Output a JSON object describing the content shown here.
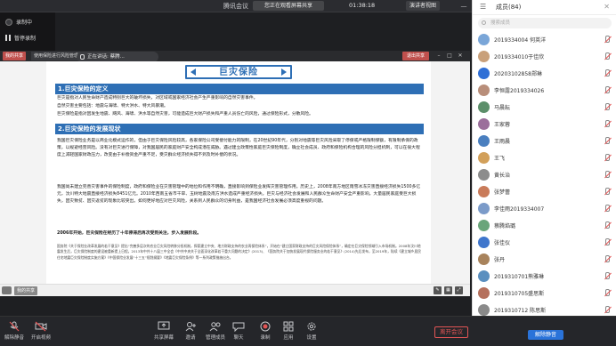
{
  "titlebar": {
    "title": "腾讯会议",
    "share_banner": "您正在观看屏幕共享",
    "timer": "01:38:18",
    "rec_label": "",
    "view_button": "演讲者视图",
    "controls": [
      "—",
      "□",
      "✕"
    ]
  },
  "recording": {
    "status": "录制中",
    "pause": "暂停录制"
  },
  "share_strip": {
    "tag": "我的共享",
    "tab": "使用保险进行风险管理",
    "exit": "退出共享"
  },
  "speaker": {
    "label": "正在讲话: 蔡腾..."
  },
  "slide": {
    "title": "巨灾保险",
    "section1": "1.巨灾保险的定义",
    "para1": "巨灾是指对人民生命财产造成特别巨大的破坏损失，对区域或国家经济社会产生严重影响的自然灾害事件。",
    "para2": "自然灾害主要包括：地震与海啸、特大洪水、特大风暴潮。",
    "para3": "巨灾保险是指对因发生地震、飓风、海啸、洪水等自然灾害，可能造成巨大财产损失和严重人员伤亡的风险，通过保险形式，分散风险。",
    "section2": "2.巨灾保险的发展现状",
    "para4": "我国巨灾保险业务是以商业化模式运作的，但由于巨灾保险风险较高，各家保险公司受偿付能力的限制，在20世纪90年代，分别对地震等巨灾风险采取了停保或严格限制保额，有限制承保的政策，以规避经营风险。没有对巨灾进行保障，对我国居民的家庭财产安全构成潜在威胁。遇过建立政策性家庭巨灾保险制度，确立社会成员、政府和保险机构合理的风险分担机制，可以在很大程度上减轻国家财政压力，改变由于补偿资金严重不足，受灾群众经济损失得不到及时补偿的状况。",
    "para5": "我国尚未建立完善灾害事件的保险制度，政府和保险业在灾害管理中的地位和作用不明确，直接影响到保险业发挥灾害管理作用。历史上，2008年南方地区雨雪冰冻灾害直接经济损失1500多亿元，汶川特大地震直接经济损失8451亿元。2010年西南五省市干旱、玉树地震及南方洪水造成严重经济损失。巨灾与经济社会发展和人民群众生命财产安全严重影响，大量居民家庭受巨大损失，因灾致贫、因灾返贫的现象比较突出。如何更好地应对巨灾风险，关系到人民群众的切身利益，是我国经济社会发展必须高度重视的问题。",
    "para6": "2006年开始，巨灾保险在经历了十年停滞后再次受到关注，步入发展阶段。",
    "para7": "国务院《关于保险业改革发展的若干意见》提出“完善多层次的农业巨灾风险转移分担机制，探索建立中央、地方财政支持的农业再保险体系”，开始在“建立国家财政支持的巨灾风险保险体系”，确定在巨灾保险领域引入市场机制。2008年汶川地震发生后，巨灾保险制度的建设被重新提上日程。2013年中共十八届三中全会《中共中央关于全面深化改革若干重大问题的决定》(2013)、《国务院关于加快发展现代保险服务业的若干意见》(2014)先后发布，至2019年，陆续《建立城乡居民住宅地震巨灾保险制度实施方案》《中国保险业发展“十三五”规划纲要》《地震巨灾保险条例》等一系列政策措施出台。"
  },
  "doc_foot": {
    "label": "我的共享"
  },
  "toolbar": {
    "buttons": [
      {
        "label": "解除静音"
      },
      {
        "label": "开启视频"
      },
      {
        "label": "共享屏幕"
      },
      {
        "label": "邀请"
      },
      {
        "label": "管理成员"
      },
      {
        "label": "聊天"
      },
      {
        "label": "录制"
      },
      {
        "label": "应用"
      },
      {
        "label": "设置"
      }
    ],
    "leave": "离开会议",
    "unmute_all": "解除静音"
  },
  "panel": {
    "title": "成员(84)",
    "search_placeholder": "搜索成员",
    "members": [
      {
        "name": "2019334004 何英洋",
        "color": "#7aa6d8"
      },
      {
        "name": "2019334010于佳欣",
        "color": "#c9a07a"
      },
      {
        "name": "20203102858郑琳",
        "color": "#2f6fd6"
      },
      {
        "name": "李恒露2019334026",
        "color": "#b88e7a"
      },
      {
        "name": "马晨耘",
        "color": "#5c8f6a"
      },
      {
        "name": "王家蓉",
        "color": "#9b6f9b"
      },
      {
        "name": "王雨晨",
        "color": "#4a7fbf"
      },
      {
        "name": "王飞",
        "color": "#d2a05a"
      },
      {
        "name": "黄长治",
        "color": "#8c8c8c"
      },
      {
        "name": "张梦蕾",
        "color": "#c97b5a"
      },
      {
        "name": "李佳雨2019334007",
        "color": "#7b9bc9"
      },
      {
        "name": "蔡腾焰璐",
        "color": "#6aa57a"
      },
      {
        "name": "张佳仪",
        "color": "#3f76cc"
      },
      {
        "name": "张丹",
        "color": "#a8835c"
      },
      {
        "name": "2019310701熊雅琳",
        "color": "#5a8fbf"
      },
      {
        "name": "2019310705盛思斯",
        "color": "#b5705c"
      },
      {
        "name": "2019310712 陈思斯",
        "color": "#8a8a8a"
      }
    ]
  }
}
